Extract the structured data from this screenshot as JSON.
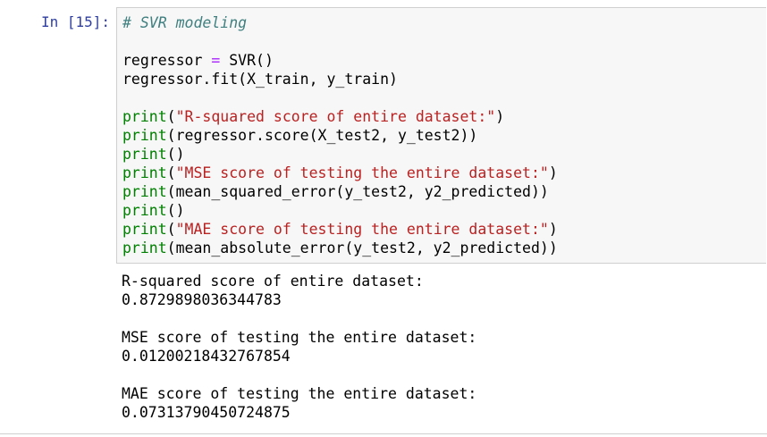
{
  "cell": {
    "prompt": "In [15]:",
    "code": {
      "comment": "# SVR modeling",
      "line_regressor_lhs": "regressor ",
      "line_regressor_op": "=",
      "line_regressor_rhs": " SVR()",
      "line_fit": "regressor.fit(X_train, y_train)",
      "print_fn": "print",
      "print1_arg_open": "(",
      "print1_str": "\"R-squared score of entire dataset:\"",
      "print1_close": ")",
      "print2_arg": "(regressor.score(X_test2, y_test2))",
      "print3_arg": "()",
      "print4_str": "\"MSE score of testing the entire dataset:\"",
      "print5_arg": "(mean_squared_error(y_test2, y2_predicted))",
      "print6_arg": "()",
      "print7_str": "\"MAE score of testing the entire dataset:\"",
      "print8_arg": "(mean_absolute_error(y_test2, y2_predicted))"
    },
    "output": [
      "R-squared score of entire dataset:",
      "0.8729898036344783",
      "",
      "MSE score of testing the entire dataset:",
      "0.01200218432767854",
      "",
      "MAE score of testing the entire dataset:",
      "0.07313790450724875"
    ]
  }
}
